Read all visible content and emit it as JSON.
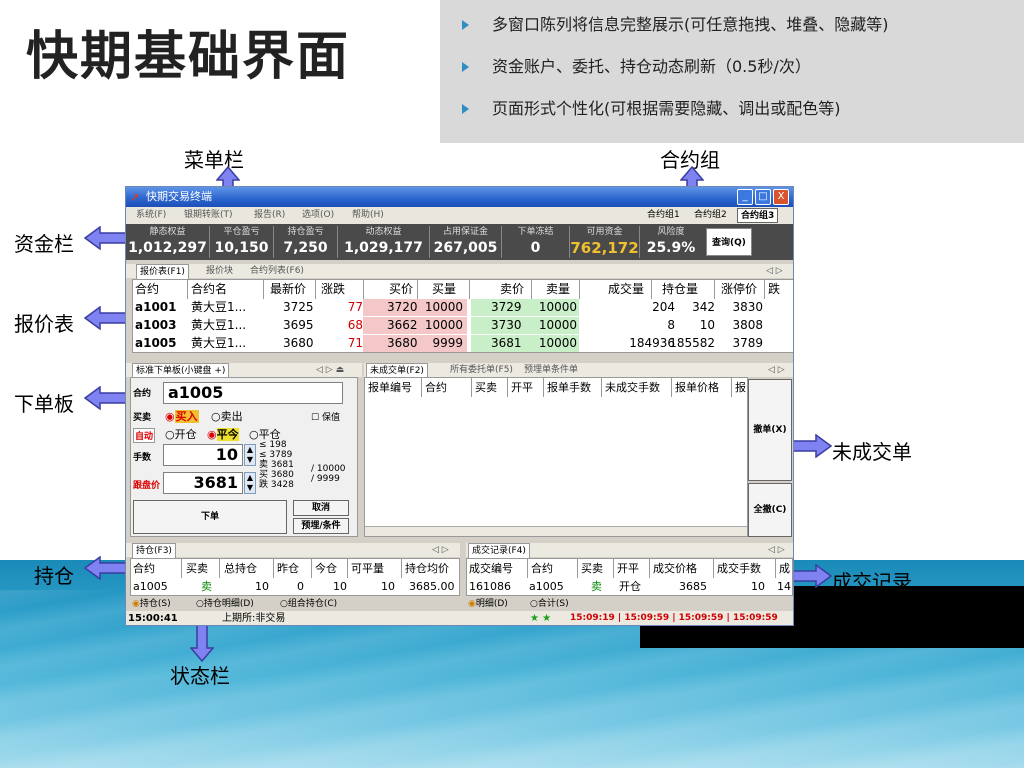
{
  "slide": {
    "title": "快期基础界面",
    "features": [
      "多窗口陈列将信息完整展示(可任意拖拽、堆叠、隐藏等)",
      "资金账户、委托、持仓动态刷新（0.5秒/次）",
      "页面形式个性化(可根据需要隐藏、调出或配色等)"
    ],
    "callouts": {
      "menu": "菜单栏",
      "contract_group": "合约组",
      "fund": "资金栏",
      "quote": "报价表",
      "order_board": "下单板",
      "pending": "未成交单",
      "position": "持仓",
      "trades": "成交记录",
      "status": "状态栏"
    }
  },
  "window": {
    "title": "快期交易终端",
    "controls": [
      "_",
      "□",
      "X"
    ],
    "menu": [
      "系统(F)",
      "银期转账(T)",
      "报告(R)",
      "选项(O)",
      "帮助(H)"
    ],
    "contract_groups": [
      "合约组1",
      "合约组2",
      "合约组3"
    ],
    "fund_headers": [
      "静态权益",
      "平仓盈亏",
      "持仓盈亏",
      "动态权益",
      "占用保证金",
      "下单冻结",
      "可用资金",
      "风险度"
    ],
    "fund_values": [
      "1,012,297",
      "10,150",
      "7,250",
      "1,029,177",
      "267,005",
      "0",
      "762,172",
      "25.9%"
    ],
    "query_button": "查询(Q)",
    "quote_tabs": [
      "报价表(F1)",
      "报价块",
      "合约列表(F6)"
    ],
    "quote_headers": [
      "合约",
      "合约名",
      "最新价",
      "涨跌",
      "买价",
      "买量",
      "卖价",
      "卖量",
      "成交量",
      "持仓量",
      "涨停价",
      "跌"
    ],
    "quote_rows": [
      [
        "a1001",
        "黄大豆1...",
        "3725",
        "77",
        "3720",
        "10000",
        "3729",
        "10000",
        "204",
        "342",
        "3830"
      ],
      [
        "a1003",
        "黄大豆1...",
        "3695",
        "68",
        "3662",
        "10000",
        "3730",
        "10000",
        "8",
        "10",
        "3808"
      ],
      [
        "a1005",
        "黄大豆1...",
        "3680",
        "71",
        "3680",
        "9999",
        "3681",
        "10000",
        "184936",
        "185582",
        "3789"
      ]
    ],
    "order_board": {
      "tab": "标准下单板(小键盘 +)",
      "contract_label": "合约",
      "contract_value": "a1005",
      "direction_label": "买卖",
      "buy": "买入",
      "sell": "卖出",
      "hedge": "保值",
      "auto_label": "自动",
      "open": "开仓",
      "close_today": "平今",
      "close": "平仓",
      "qty_label": "手数",
      "qty_value": "10",
      "qty_hints": [
        "≤ 198",
        "≤ 3789"
      ],
      "price_label": "跟盘价",
      "price_value": "3681",
      "price_hints": [
        "3681",
        "3680",
        "3428"
      ],
      "price_hint_sym": [
        "卖",
        "买",
        "跌"
      ],
      "vol_hints": [
        "/ 10000",
        "/ 9999"
      ],
      "place_button": "下单",
      "cancel_button": "取消",
      "preset_button": "预埋/条件"
    },
    "pending_tabs": [
      "未成交单(F2)",
      "所有委托单(F5)",
      "预埋单条件单"
    ],
    "pending_headers": [
      "报单编号",
      "合约",
      "买卖",
      "开平",
      "报单手数",
      "未成交手数",
      "报单价格",
      "报"
    ],
    "cancel_button": "撤单(X)",
    "cancel_all_button": "全撤(C)",
    "position": {
      "tab": "持仓(F3)",
      "headers": [
        "合约",
        "买卖",
        "总持仓",
        "昨仓",
        "今仓",
        "可平量",
        "持仓均价"
      ],
      "row": [
        "a1005",
        "卖",
        "10",
        "0",
        "10",
        "10",
        "3685.00"
      ],
      "radios": [
        "持仓(S)",
        "持仓明细(D)",
        "组合持仓(C)"
      ]
    },
    "trades": {
      "tab": "成交记录(F4)",
      "headers": [
        "成交编号",
        "合约",
        "买卖",
        "开平",
        "成交价格",
        "成交手数",
        "成"
      ],
      "row": [
        "161086",
        "a1005",
        "卖",
        "开仓",
        "3685",
        "10",
        "14"
      ],
      "radios": [
        "明细(D)",
        "合计(S)"
      ]
    },
    "status": {
      "time": "15:00:41",
      "exchange": "上期所:非交易",
      "clocks": "15:09:19 | 15:09:59 | 15:09:59 | 15:09:59"
    }
  },
  "colors": {
    "arrow_fill": "#7f83f2",
    "arrow_stroke": "#3b3da0",
    "available_funds": "#f0c030",
    "down_red": "#d00000",
    "buy_bg": "#f4c8c8",
    "sell_bg": "#c8efc8"
  }
}
